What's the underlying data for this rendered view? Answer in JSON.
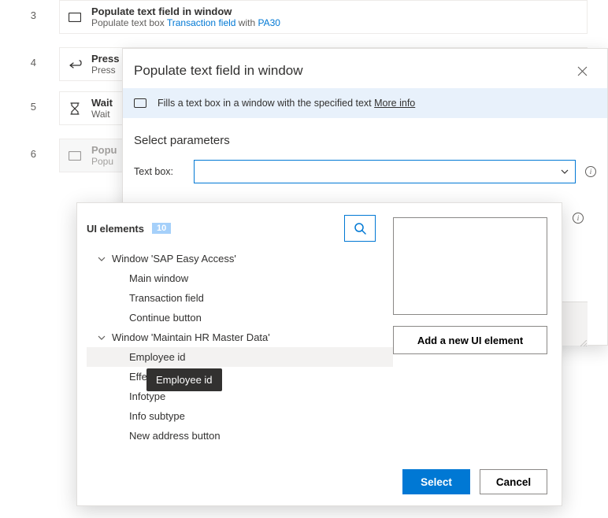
{
  "steps": [
    {
      "num": "3",
      "title": "Populate text field in window",
      "sub_pre": "Populate text box ",
      "link1": "Transaction field",
      "mid": " with ",
      "link2": "PA30",
      "icon": "textbox"
    },
    {
      "num": "4",
      "title": "Press",
      "sub_pre": "Press",
      "icon": "enterkey"
    },
    {
      "num": "5",
      "title": "Wait",
      "sub_pre": "Wait",
      "icon": "hourglass"
    },
    {
      "num": "6",
      "title": "Popu",
      "sub_pre": "Popu",
      "icon": "textbox",
      "dim": true
    }
  ],
  "dialog": {
    "title": "Populate text field in window",
    "info_text": "Fills a text box in a window with the specified text ",
    "more_info": "More info",
    "section": "Select parameters",
    "param_label": "Text box:"
  },
  "picker": {
    "heading": "UI elements",
    "count": "10",
    "add_label": "Add a new UI element",
    "select": "Select",
    "cancel": "Cancel",
    "tree": {
      "group1": "Window 'SAP Easy Access'",
      "g1_items": [
        "Main window",
        "Transaction field",
        "Continue button"
      ],
      "group2": "Window 'Maintain HR Master Data'",
      "g2_items": [
        "Employee id",
        "Effecti",
        "Infotype",
        "Info subtype",
        "New address button"
      ]
    }
  },
  "tooltip": "Employee id"
}
